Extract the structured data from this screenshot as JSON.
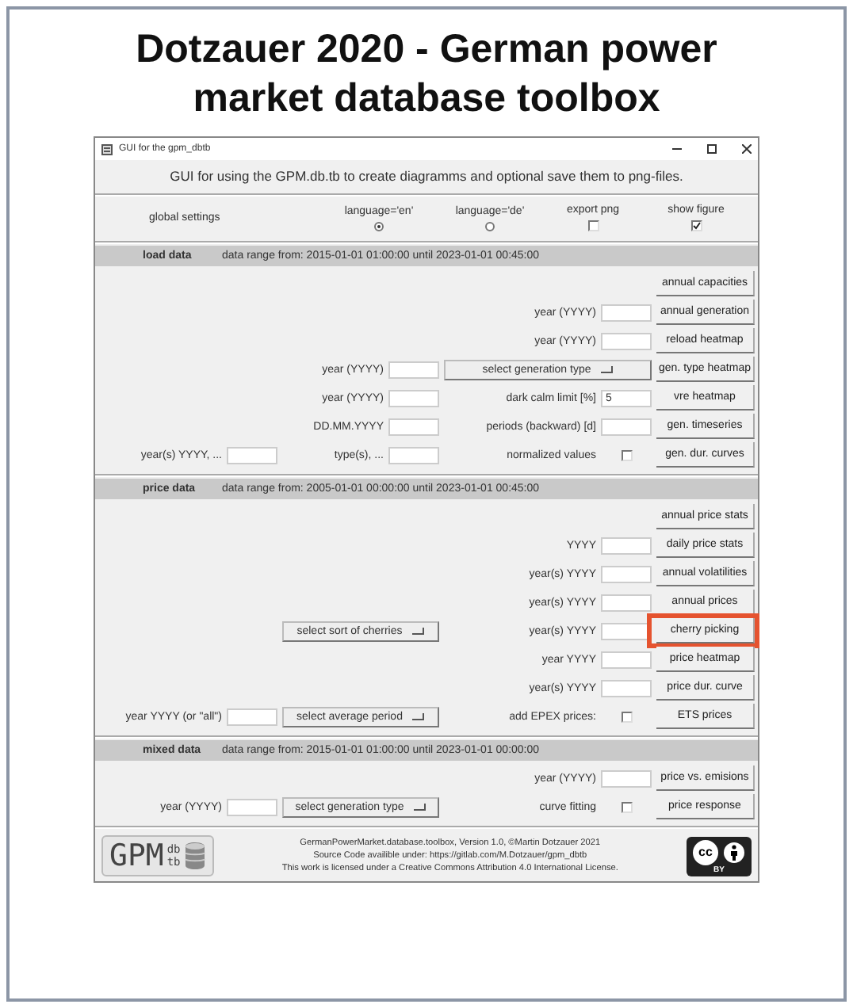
{
  "slide_title": "Dotzauer 2020 - German power market database toolbox",
  "window": {
    "title": "GUI for the gpm_dbtb"
  },
  "headline": "GUI for using the GPM.db.tb to create diagramms and optional save them to png-files.",
  "global_settings": {
    "label": "global settings",
    "options": [
      {
        "kind": "radio",
        "label": "language='en'",
        "selected": true
      },
      {
        "kind": "radio",
        "label": "language='de'",
        "selected": false
      },
      {
        "kind": "checkbox",
        "label": "export png",
        "checked": false
      },
      {
        "kind": "checkbox",
        "label": "show figure",
        "checked": true
      }
    ]
  },
  "sections": [
    {
      "title": "load data",
      "range": "data range from: 2015-01-01 01:00:00 until 2023-01-01 00:45:00",
      "rows": [
        {
          "button": {
            "label": "annual capacities",
            "highlighted": false
          }
        },
        {
          "right": {
            "label": "year (YYYY)",
            "field": true
          },
          "button": {
            "label": "annual generation",
            "highlighted": false
          }
        },
        {
          "right": {
            "label": "year (YYYY)",
            "field": true
          },
          "button": {
            "label": "reload heatmap",
            "highlighted": false
          }
        },
        {
          "middle": {
            "label": "year (YYYY)",
            "field": true
          },
          "right": {
            "dropdown": "select generation type"
          },
          "button": {
            "label": "gen. type heatmap",
            "highlighted": false
          }
        },
        {
          "middle": {
            "label": "year (YYYY)",
            "field": true
          },
          "right": {
            "label": "dark calm limit [%]",
            "field": true,
            "value": "5"
          },
          "button": {
            "label": "vre heatmap",
            "highlighted": false
          }
        },
        {
          "middle": {
            "label": "DD.MM.YYYY",
            "field": true
          },
          "right": {
            "label": "periods (backward) [d]",
            "field": true
          },
          "button": {
            "label": "gen. timeseries",
            "highlighted": false
          }
        },
        {
          "left": {
            "label": "year(s) YYYY, ...",
            "field": true
          },
          "middle": {
            "label": "type(s), ...",
            "field": true
          },
          "right": {
            "label": "normalized values",
            "checkbox": {
              "checked": false
            }
          },
          "button": {
            "label": "gen. dur. curves",
            "highlighted": false
          }
        }
      ]
    },
    {
      "title": "price data",
      "range": "data range from: 2005-01-01 00:00:00 until 2023-01-01 00:45:00",
      "rows": [
        {
          "button": {
            "label": "annual price stats",
            "highlighted": false
          }
        },
        {
          "right": {
            "label": "YYYY",
            "field": true
          },
          "button": {
            "label": "daily price stats",
            "highlighted": false
          }
        },
        {
          "right": {
            "label": "year(s) YYYY",
            "field": true
          },
          "button": {
            "label": "annual volatilities",
            "highlighted": false
          }
        },
        {
          "right": {
            "label": "year(s) YYYY",
            "field": true
          },
          "button": {
            "label": "annual prices",
            "highlighted": false
          }
        },
        {
          "middle": {
            "dropdown": "select sort of cherries"
          },
          "right": {
            "label": "year(s) YYYY",
            "field": true
          },
          "button": {
            "label": "cherry picking",
            "highlighted": true
          }
        },
        {
          "right": {
            "label": "year YYYY",
            "field": true
          },
          "button": {
            "label": "price heatmap",
            "highlighted": false
          }
        },
        {
          "right": {
            "label": "year(s) YYYY",
            "field": true
          },
          "button": {
            "label": "price dur. curve",
            "highlighted": false
          }
        },
        {
          "left": {
            "label": "year YYYY (or \"all\")",
            "field": true
          },
          "middle": {
            "dropdown": "select average period"
          },
          "right": {
            "label": "add EPEX prices:",
            "checkbox": {
              "checked": false
            }
          },
          "button": {
            "label": "ETS prices",
            "highlighted": false
          }
        }
      ]
    },
    {
      "title": "mixed data",
      "range": "data range from: 2015-01-01 01:00:00 until 2023-01-01 00:00:00",
      "rows": [
        {
          "right": {
            "label": "year (YYYY)",
            "field": true
          },
          "button": {
            "label": "price vs. emisions",
            "highlighted": false
          }
        },
        {
          "left": {
            "label": "year (YYYY)",
            "field": true
          },
          "middle": {
            "dropdown": "select generation type"
          },
          "right": {
            "label": "curve fitting",
            "checkbox": {
              "checked": false
            }
          },
          "button": {
            "label": "price response",
            "highlighted": false
          }
        }
      ]
    }
  ],
  "footer": {
    "logo": {
      "name": "GPM",
      "top": "db",
      "bottom": "tb"
    },
    "lines": [
      "GermanPowerMarket.database.toolbox, Version 1.0, ©Martin Dotzauer 2021",
      "Source Code availible under: https://gitlab.com/M.Dotzauer/gpm_dbtb",
      "This work is licensed under a Creative Commons Attribution 4.0 International License."
    ],
    "license": {
      "mark": "cc",
      "label": "BY"
    }
  }
}
